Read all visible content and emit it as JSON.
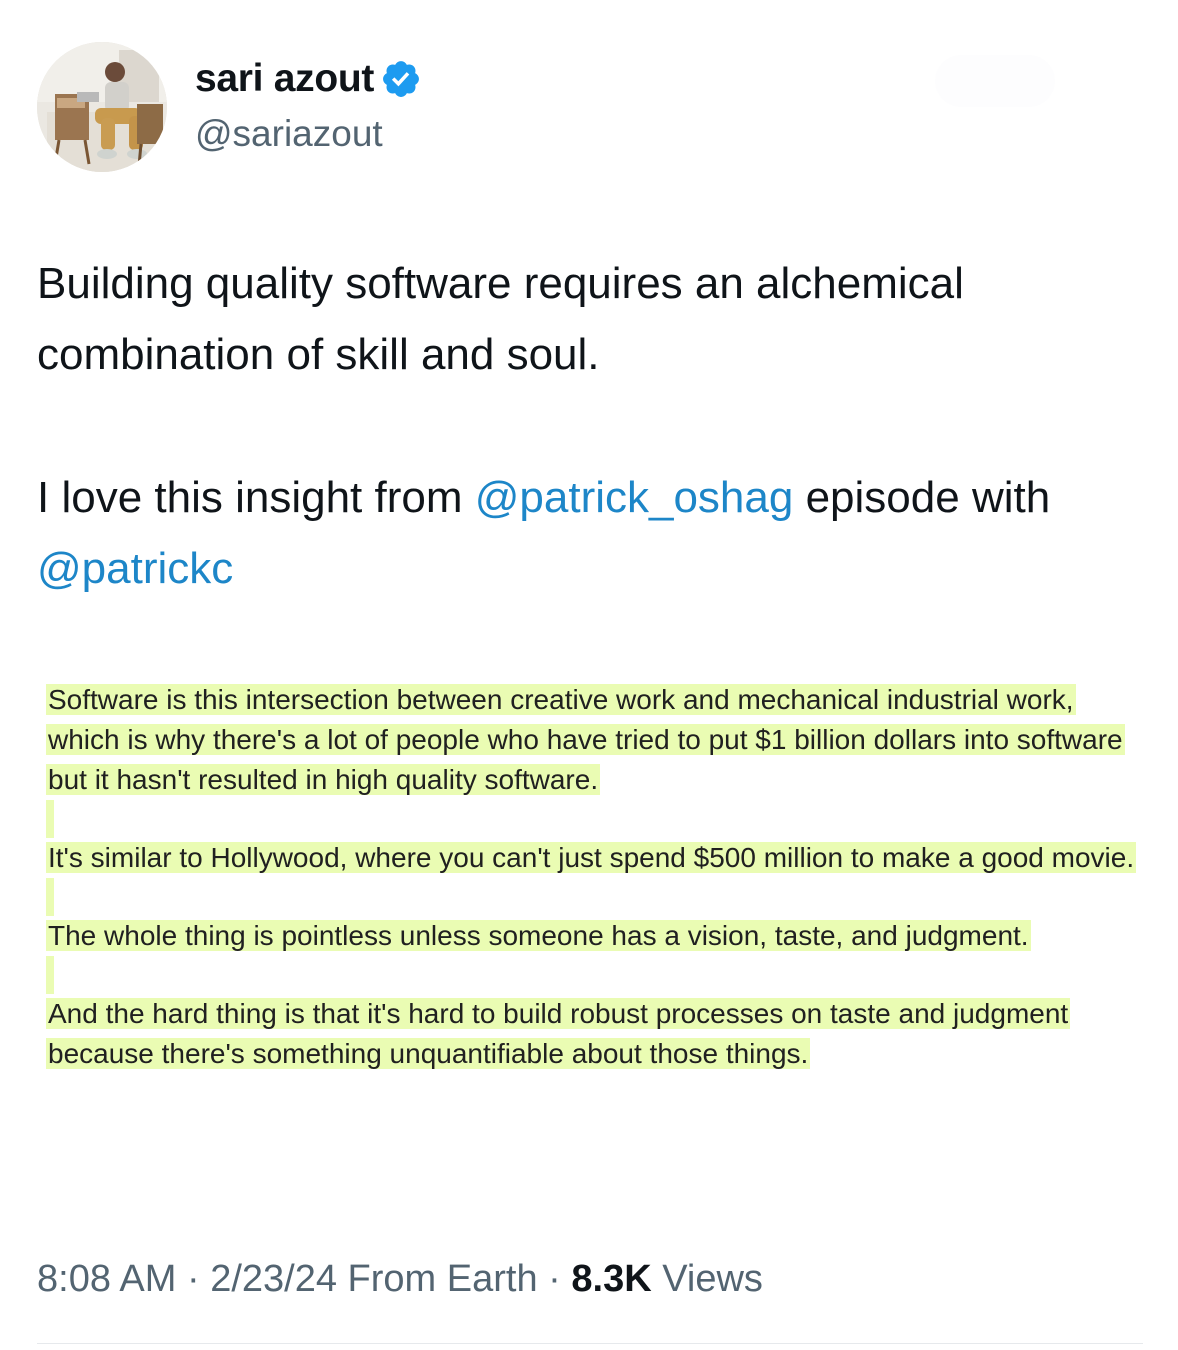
{
  "author": {
    "display_name": "sari azout",
    "handle": "@sariazout",
    "verified_color": "#1d9bf0"
  },
  "tweet": {
    "line1": "Building quality software requires an alchemical combination of skill and soul.",
    "line2_prefix": "I love this insight from ",
    "mention1": "@patrick_oshag",
    "line2_middle": " episode with ",
    "mention2": "@patrickc"
  },
  "quote_paragraphs": [
    "Software is this intersection between creative work and mechanical industrial work, which is why there's a lot of people who have tried to put $1 billion dollars into software but it hasn't resulted in high quality software.",
    "It's similar to Hollywood, where you can't just spend $500 million to make a good movie.",
    "The whole thing is pointless unless someone has a vision, taste, and judgment.",
    "And the hard thing is that it's hard to build robust processes on taste and judgment because there's something unquantifiable about those things."
  ],
  "meta": {
    "time": "8:08 AM",
    "sep1": " · ",
    "date": "2/23/24",
    "location": " From Earth",
    "sep2": " · ",
    "views_count": "8.3K",
    "views_label": " Views"
  },
  "colors": {
    "highlight": "#eafcb3",
    "mention": "#1d86c8",
    "secondary_text": "#536471"
  }
}
